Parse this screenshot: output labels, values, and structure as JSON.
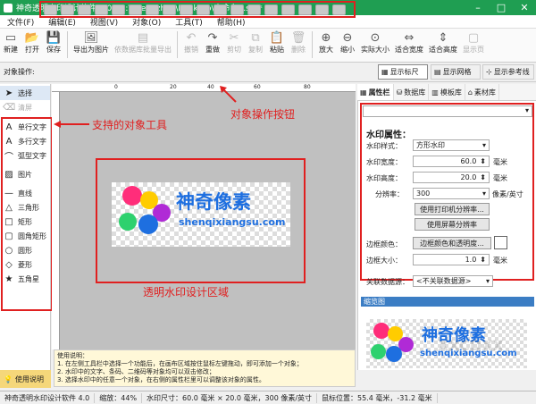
{
  "window": {
    "title": "神奇透明水印设计软件 4.0 - C:\\Users\\zhou\\Desktop\\未命名1.stb*"
  },
  "menu": [
    "文件(F)",
    "编辑(E)",
    "视图(V)",
    "对象(O)",
    "工具(T)",
    "帮助(H)"
  ],
  "toolbar": [
    {
      "label": "新建",
      "icon": "new-doc-icon",
      "enabled": true
    },
    {
      "label": "打开",
      "icon": "open-folder-icon",
      "enabled": true
    },
    {
      "label": "保存",
      "icon": "save-icon",
      "enabled": true
    },
    {
      "label": "导出为图片",
      "icon": "export-image-icon",
      "enabled": true
    },
    {
      "label": "依数据库批量导出",
      "icon": "batch-export-icon",
      "enabled": false
    },
    {
      "label": "撤销",
      "icon": "undo-icon",
      "enabled": false
    },
    {
      "label": "重做",
      "icon": "redo-icon",
      "enabled": true
    },
    {
      "label": "剪切",
      "icon": "cut-icon",
      "enabled": false
    },
    {
      "label": "复制",
      "icon": "copy-icon",
      "enabled": false
    },
    {
      "label": "粘贴",
      "icon": "paste-icon",
      "enabled": true
    },
    {
      "label": "删除",
      "icon": "delete-icon",
      "enabled": false
    },
    {
      "label": "放大",
      "icon": "zoom-in-icon",
      "enabled": true
    },
    {
      "label": "缩小",
      "icon": "zoom-out-icon",
      "enabled": true
    },
    {
      "label": "实际大小",
      "icon": "actual-size-icon",
      "enabled": true
    },
    {
      "label": "适合宽度",
      "icon": "fit-width-icon",
      "enabled": true
    },
    {
      "label": "适合高度",
      "icon": "fit-height-icon",
      "enabled": true
    },
    {
      "label": "显示页",
      "icon": "show-page-icon",
      "enabled": false
    }
  ],
  "objbar": {
    "label": "对象操作:",
    "toggles": [
      "显示标尺",
      "显示网格",
      "显示参考线"
    ]
  },
  "tools": [
    {
      "label": "选择",
      "icon": "pointer-icon"
    },
    {
      "label": "清屏",
      "icon": "clear-icon"
    },
    {
      "label": "单行文字",
      "icon": "single-text-icon"
    },
    {
      "label": "多行文字",
      "icon": "multi-text-icon"
    },
    {
      "label": "弧型文字",
      "icon": "arc-text-icon"
    },
    {
      "label": "图片",
      "icon": "image-icon"
    },
    {
      "label": "直线",
      "icon": "line-icon"
    },
    {
      "label": "三角形",
      "icon": "triangle-icon"
    },
    {
      "label": "矩形",
      "icon": "rectangle-icon"
    },
    {
      "label": "圆角矩形",
      "icon": "rounded-rect-icon"
    },
    {
      "label": "圆形",
      "icon": "circle-icon"
    },
    {
      "label": "菱形",
      "icon": "diamond-icon"
    },
    {
      "label": "五角星",
      "icon": "star-icon"
    }
  ],
  "ruler": {
    "marks": [
      "0",
      "20",
      "40",
      "60",
      "80"
    ]
  },
  "annotations": {
    "tools": "支持的对象工具",
    "objops": "对象操作按钮",
    "design": "透明水印设计区域"
  },
  "watermark": {
    "title": "神奇像素",
    "subtitle": "shenqixiangsu.com",
    "dot_colors": [
      "#ff2d7a",
      "#ffcc00",
      "#b02ad6",
      "#2ed16e",
      "#1e6fe0"
    ]
  },
  "right_tabs": [
    "属性栏",
    "数据库",
    "模板库",
    "素材库"
  ],
  "props": {
    "title": "水印属性：",
    "style_label": "水印样式：",
    "style_value": "方形水印",
    "width_label": "水印宽度：",
    "width_value": "60.0",
    "height_label": "水印高度：",
    "height_value": "20.0",
    "unit": "毫米",
    "resolution_label": "分辨率：",
    "resolution_value": "300",
    "resolution_unit": "像素/英寸",
    "btn_printer": "使用打印机分辨率...",
    "btn_screen": "使用屏幕分辨率",
    "border_color_label": "边框颜色：",
    "btn_border_color": "边框颜色和透明度...",
    "border_size_label": "边框大小：",
    "border_size_value": "1.0",
    "datasource_label": "关联数据源：",
    "datasource_value": "<不关联数据源>"
  },
  "preview": {
    "header": "缩览图",
    "watermark_text": "XXCDXX"
  },
  "help": {
    "title": "使用说明：",
    "lines": [
      "1. 在左侧工具栏中选择一个功能后，在画布区域按住鼠标左键拖动，即可添加一个对象；",
      "2. 水印中的文字、条码、二维码等对象均可以双击修改；",
      "3. 选择水印中的任意一个对象，在右侧的属性栏里可以调整该对象的属性。"
    ]
  },
  "usage_button": "使用说明",
  "status": {
    "app": "神奇透明水印设计软件 4.0",
    "zoom": "缩放：44%",
    "size": "水印尺寸：60.0 毫米 × 20.0 毫米，300 像素/英寸",
    "cursor": "鼠标位置：55.4 毫米，-31.2 毫米"
  }
}
